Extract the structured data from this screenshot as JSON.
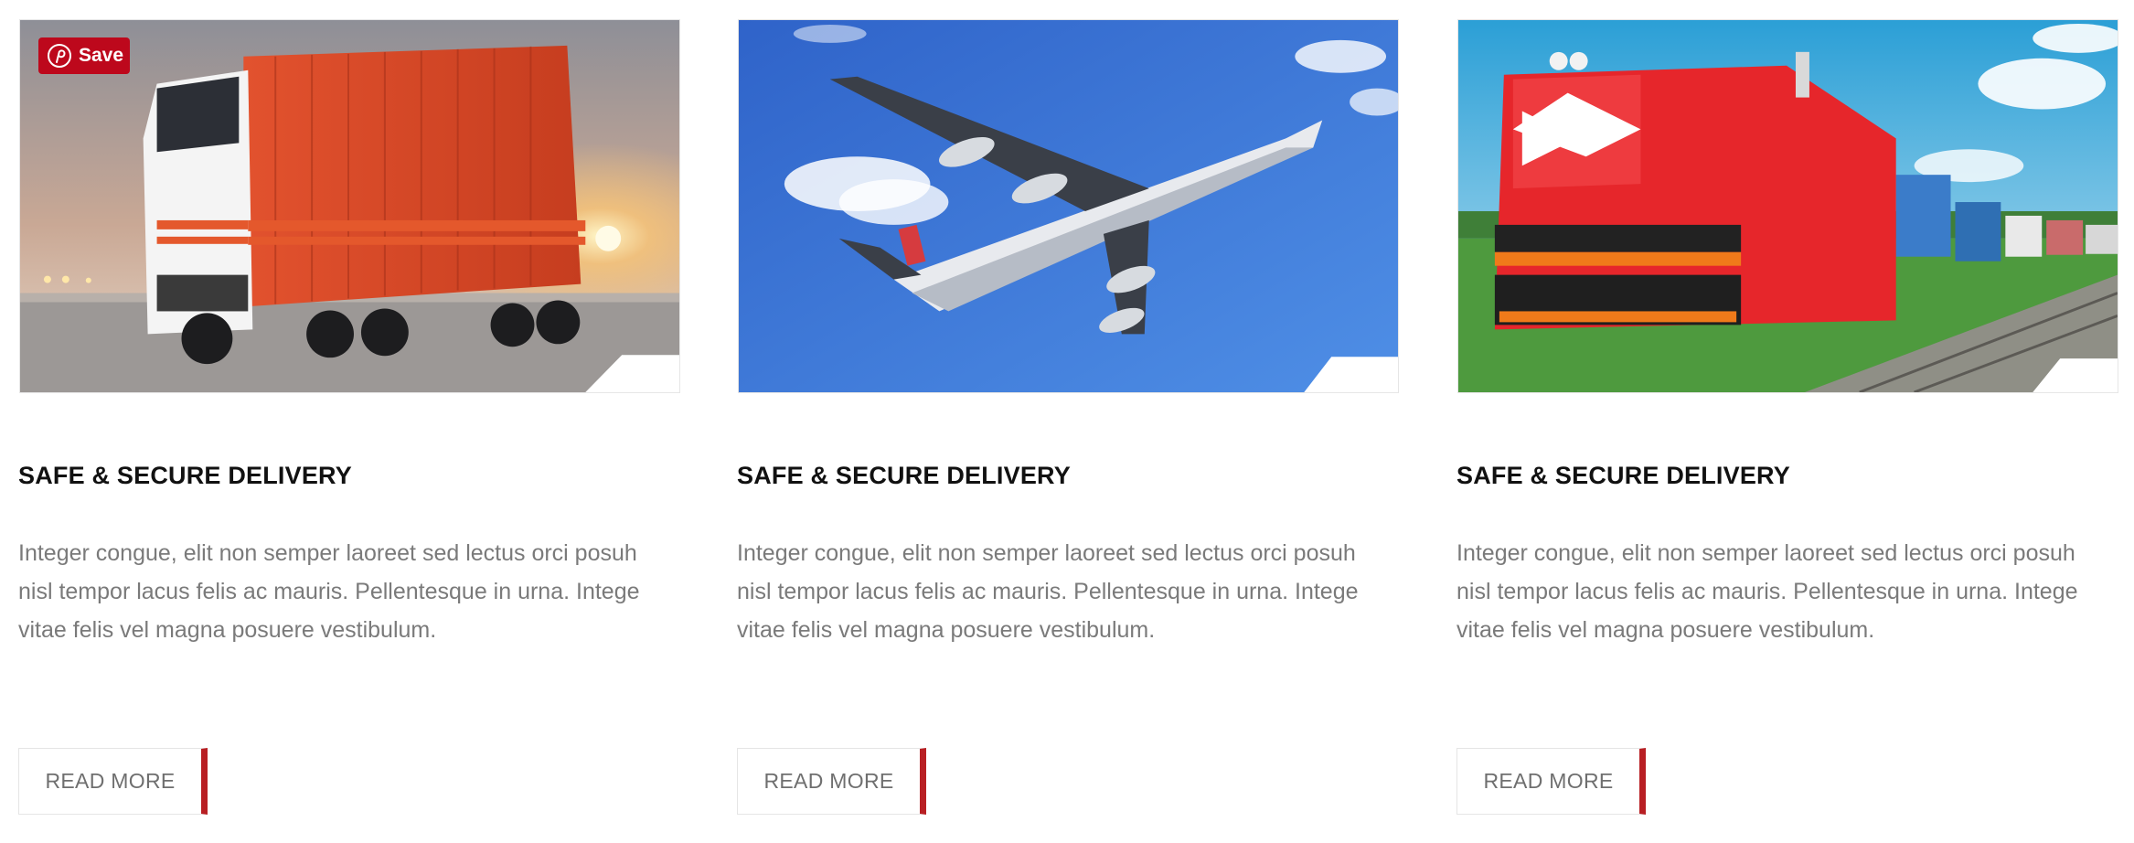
{
  "colors": {
    "accent": "#b81f23",
    "pinterest": "#bd081c",
    "title": "#111111",
    "body_text": "#7a7a7a"
  },
  "save_button": {
    "label": "Save",
    "icon": "pinterest-icon"
  },
  "cards": [
    {
      "image": "truck-photo",
      "title": "SAFE & SECURE DELIVERY",
      "lines": [
        "Integer congue, elit non semper laoreet sed lectus orci posuh",
        "nisl tempor lacus felis ac mauris. Pellentesque in urna. Intege",
        "vitae felis vel magna posuere vestibulum."
      ],
      "button": "READ MORE"
    },
    {
      "image": "airplane-photo",
      "title": "SAFE & SECURE DELIVERY",
      "lines": [
        "Integer congue, elit non semper laoreet sed lectus orci posuh",
        "nisl tempor lacus felis ac mauris. Pellentesque in urna. Intege",
        "vitae felis vel magna posuere vestibulum."
      ],
      "button": "READ MORE"
    },
    {
      "image": "train-photo",
      "title": "SAFE & SECURE DELIVERY",
      "lines": [
        "Integer congue, elit non semper laoreet sed lectus orci posuh",
        "nisl tempor lacus felis ac mauris. Pellentesque in urna. Intege",
        "vitae felis vel magna posuere vestibulum."
      ],
      "button": "READ MORE"
    }
  ]
}
